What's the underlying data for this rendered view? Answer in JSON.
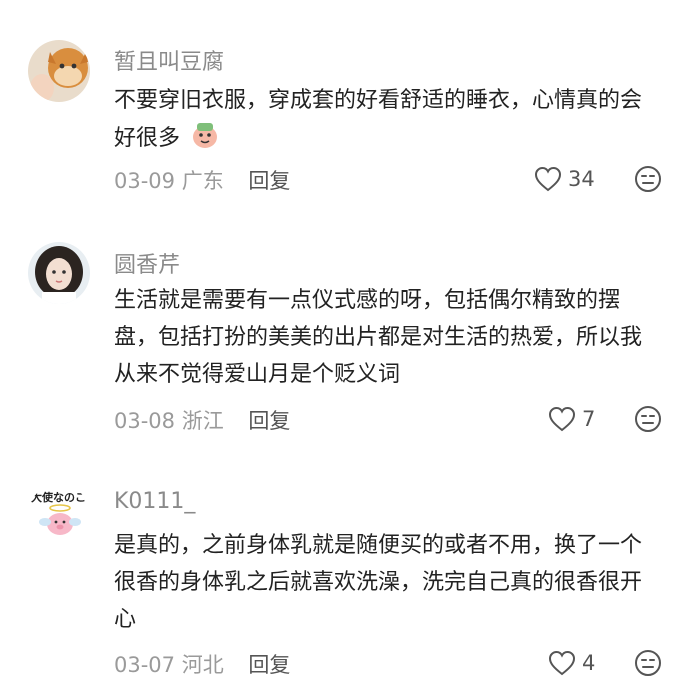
{
  "comments": [
    {
      "username": "暂且叫豆腐",
      "text": "不要穿旧衣服，穿成套的好看舒适的睡衣，心情真的会好很多",
      "date": "03-09",
      "location": "广东",
      "reply_label": "回复",
      "likes": "34",
      "avatar_icon": "cat-avatar-icon"
    },
    {
      "username": "圆香芹",
      "text": "生活就是需要有一点仪式感的呀，包括偶尔精致的摆盘，包括打扮的美美的出片都是对生活的热爱，所以我从来不觉得爱山月是个贬义词",
      "date": "03-08",
      "location": "浙江",
      "reply_label": "回复",
      "likes": "7",
      "avatar_icon": "girl-avatar-icon"
    },
    {
      "username": "K0111_",
      "text": "是真的，之前身体乳就是随便买的或者不用，换了一个很香的身体乳之后就喜欢洗澡，洗完自己真的很香很开心",
      "date": "03-07",
      "location": "河北",
      "reply_label": "回复",
      "likes": "4",
      "avatar_icon": "angel-pig-avatar-icon",
      "avatar_text": "大使なのこ"
    }
  ],
  "colors": {
    "username": "#8a8a8a",
    "text": "#222222",
    "meta": "#9a9a9a",
    "icon": "#555555"
  }
}
